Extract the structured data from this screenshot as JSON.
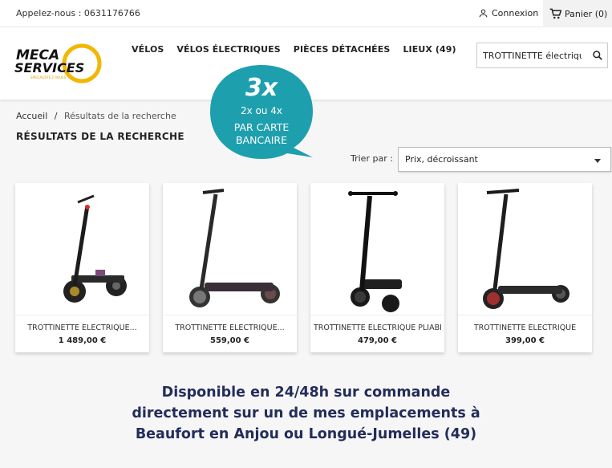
{
  "topbar": {
    "phone": "Appelez-nous : 0631176766",
    "login_label": "Connexion",
    "cart_label": "Panier (0)"
  },
  "logo": {
    "line1": "MECA",
    "line2": "SERVICES",
    "tagline": "SPÉCIALISTE 2 ROUES"
  },
  "nav": {
    "items": [
      "VÉLOS",
      "VÉLOS ÉLECTRIQUES",
      "PIÈCES DÉTACHÉES",
      "LIEUX (49)"
    ]
  },
  "search": {
    "value": "TROTTINETTE électrique"
  },
  "badge": {
    "big": "3x",
    "small": "2x ou 4x",
    "line1": "PAR CARTE",
    "line2": "BANCAIRE",
    "color": "#1e9fae"
  },
  "breadcrumb": {
    "home": "Accueil",
    "sep": "/",
    "current": "Résultats de la recherche"
  },
  "page_title": "RÉSULTATS DE LA RECHERCHE",
  "sort": {
    "label": "Trier par :",
    "selected": "Prix, décroissant"
  },
  "products": [
    {
      "name": "TROTTINETTE ÉLECTRIQUE...",
      "price": "1 489,00 €"
    },
    {
      "name": "TROTTINETTE ÉLECTRIQUE...",
      "price": "559,00 €"
    },
    {
      "name": "TROTTINETTE ÉLECTRIQUE PLIABLE",
      "price": "479,00 €"
    },
    {
      "name": "TROTTINETTE ÉLECTRIQUE",
      "price": "399,00 €"
    }
  ],
  "note": {
    "line1": "Disponible en 24/48h sur commande",
    "line2": "directement sur un de mes emplacements à",
    "line3": "Beaufort en Anjou ou Longué-Jumelles (49)"
  }
}
